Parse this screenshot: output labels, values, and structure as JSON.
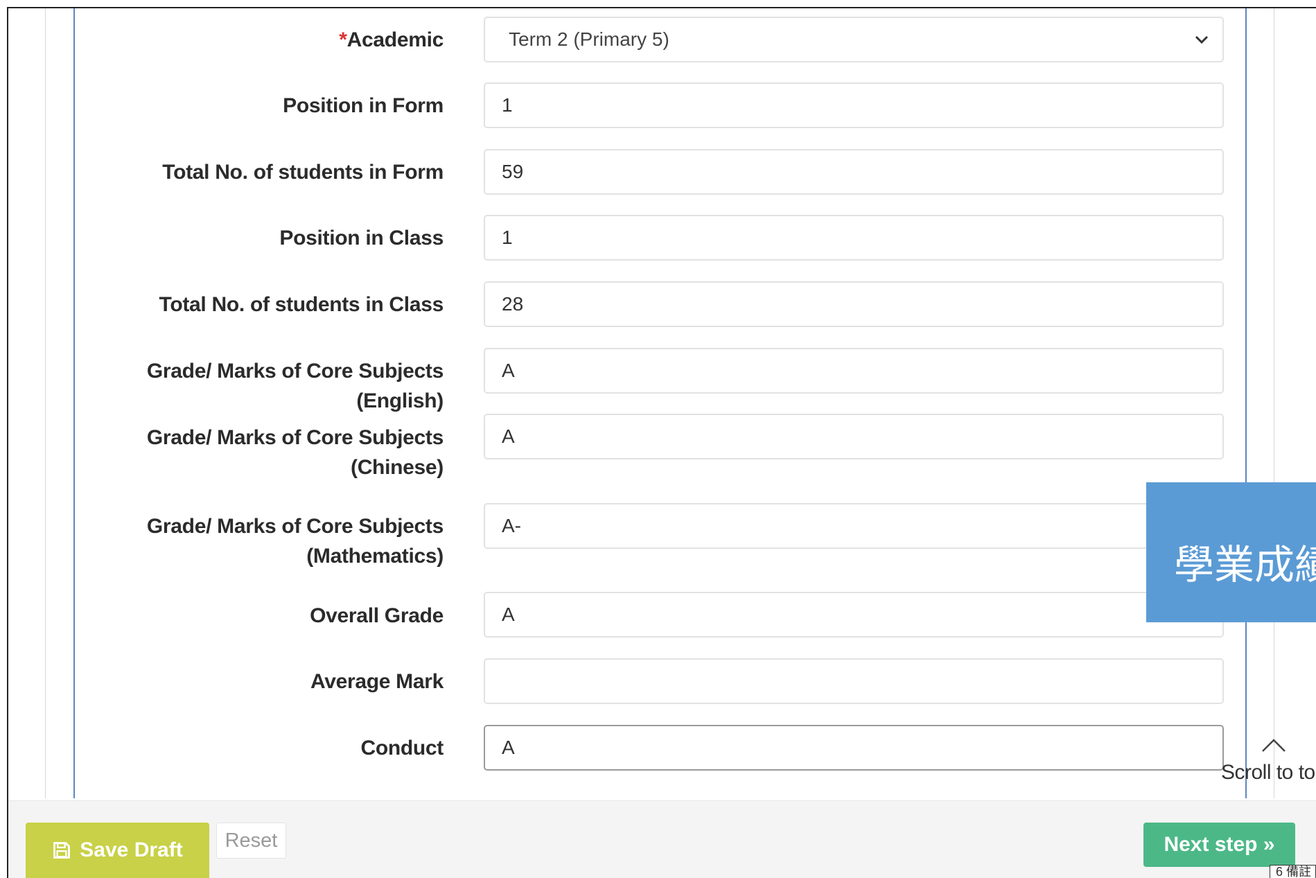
{
  "form": {
    "academic": {
      "label": "Academic",
      "required_mark": "*",
      "value": "Term 2 (Primary 5)"
    },
    "position_in_form": {
      "label": "Position in Form",
      "value": "1"
    },
    "total_students_form": {
      "label": "Total No. of students in Form",
      "value": "59"
    },
    "position_in_class": {
      "label": "Position in Class",
      "value": "1"
    },
    "total_students_class": {
      "label": "Total No. of students in Class",
      "value": "28"
    },
    "grade_english": {
      "label": "Grade/ Marks of Core Subjects (English)",
      "value": "A"
    },
    "grade_chinese": {
      "label_line1": "Grade/ Marks of Core Subjects",
      "label_line2": "(Chinese)",
      "value": "A"
    },
    "grade_math": {
      "label_line1": "Grade/ Marks of Core Subjects",
      "label_line2": "(Mathematics)",
      "value": "A-"
    },
    "overall_grade": {
      "label": "Overall Grade",
      "value": "A"
    },
    "average_mark": {
      "label": "Average Mark",
      "value": ""
    },
    "conduct": {
      "label": "Conduct",
      "value": "A"
    }
  },
  "overlay": {
    "text": "學業成績"
  },
  "scroll_to_top": {
    "label": "Scroll to top",
    "icon": "caret-up-icon"
  },
  "footer": {
    "save_draft_label": "Save Draft",
    "reset_label": "Reset",
    "next_step_label": "Next step »"
  },
  "page_badge": {
    "text": "6 備註"
  },
  "colors": {
    "save_draft": "#c8d147",
    "next_step": "#4cb887",
    "overlay": "#5b9bd5",
    "guide_line": "#5b87c4"
  }
}
